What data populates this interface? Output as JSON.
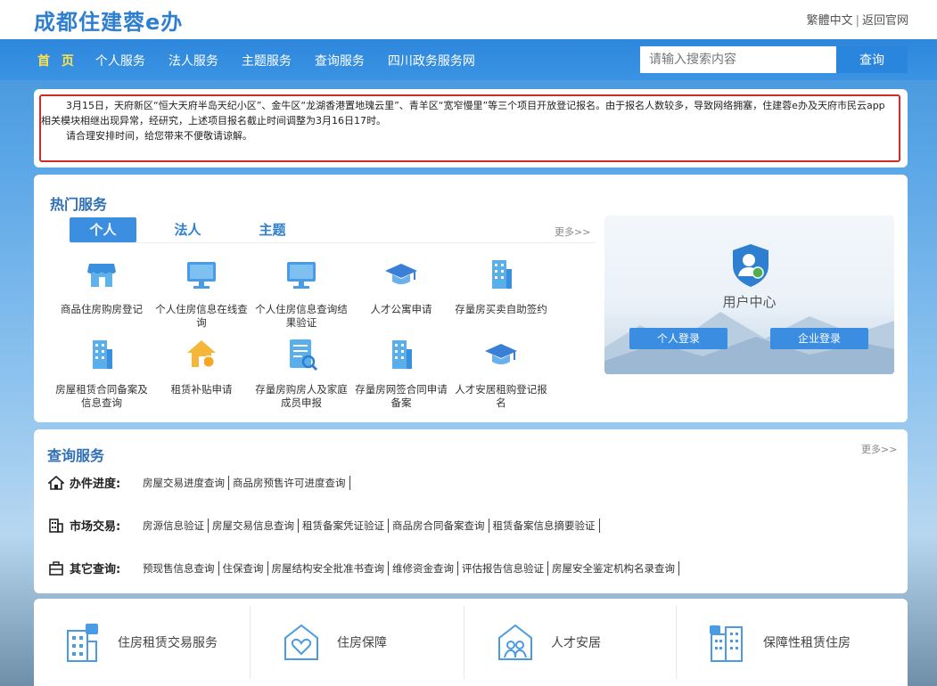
{
  "header": {
    "title": "成都住建蓉e办",
    "link_traditional": "繁體中文",
    "link_separator": "|",
    "link_official": "返回官网"
  },
  "nav": {
    "items": [
      {
        "label": "首 页",
        "active": true
      },
      {
        "label": "个人服务"
      },
      {
        "label": "法人服务"
      },
      {
        "label": "主题服务"
      },
      {
        "label": "查询服务"
      },
      {
        "label": "四川政务服务网"
      }
    ],
    "search_placeholder": "请输入搜索内容",
    "search_button": "查询"
  },
  "notice": {
    "paragraph1": "3月15日，天府新区“恒大天府半岛天纪小区”、金牛区“龙湖香港置地瑰云里”、青羊区“宽窄慢里”等三个项目开放登记报名。由于报名人数较多，导致网络拥塞，住建蓉e办及天府市民云app相关模块相继出现异常，经研究，上述项目报名截止时间调整为3月16日17时。",
    "paragraph2": "请合理安排时间，给您带来不便敬请谅解。",
    "border_color": "#d02b2b"
  },
  "hot_services": {
    "title": "热门服务",
    "tabs": [
      "个人",
      "法人",
      "主题"
    ],
    "more": "更多>>",
    "items": [
      {
        "label": "商品住房购房登记",
        "icon": "shop-icon"
      },
      {
        "label": "个人住房信息在线查询",
        "icon": "monitor-icon"
      },
      {
        "label": "个人住房信息查询结果验证",
        "icon": "monitor-icon"
      },
      {
        "label": "人才公寓申请",
        "icon": "graduation-cap-icon"
      },
      {
        "label": "存量房买卖自助签约",
        "icon": "building-icon"
      },
      {
        "label": "房屋租赁合同备案及信息查询",
        "icon": "building-icon"
      },
      {
        "label": "租赁补贴申请",
        "icon": "house-subsidy-icon"
      },
      {
        "label": "存量房购房人及家庭成员申报",
        "icon": "document-search-icon"
      },
      {
        "label": "存量房网签合同申请备案",
        "icon": "building-icon"
      },
      {
        "label": "人才安居租购登记报名",
        "icon": "graduation-cap-icon"
      }
    ],
    "user_center": {
      "title": "用户中心",
      "personal_login": "个人登录",
      "enterprise_login": "企业登录"
    }
  },
  "query_services": {
    "title": "查询服务",
    "more": "更多>>",
    "rows": [
      {
        "label": "办件进度:",
        "icon": "home-icon",
        "links": [
          "房屋交易进度查询",
          "商品房预售许可进度查询"
        ]
      },
      {
        "label": "市场交易:",
        "icon": "city-icon",
        "links": [
          "房源信息验证",
          "房屋交易信息查询",
          "租赁备案凭证验证",
          "商品房合同备案查询",
          "租赁备案信息摘要验证"
        ]
      },
      {
        "label": "其它查询:",
        "icon": "briefcase-icon",
        "links": [
          "预现售信息查询",
          "住保查询",
          "房屋结构安全批准书查询",
          "维修资金查询",
          "评估报告信息验证",
          "房屋安全鉴定机构名录查询"
        ]
      }
    ]
  },
  "bottom_services": [
    {
      "label": "住房租赁交易服务",
      "icon": "rental-building-icon"
    },
    {
      "label": "住房保障",
      "icon": "heart-house-icon"
    },
    {
      "label": "人才安居",
      "icon": "people-house-icon"
    },
    {
      "label": "保障性租赁住房",
      "icon": "rental-housing-icon"
    }
  ],
  "colors": {
    "brand": "#2f7fd0",
    "nav_bg": "#2e87dc",
    "active_nav": "#ffe34d",
    "section_title": "#2f6fb6"
  }
}
